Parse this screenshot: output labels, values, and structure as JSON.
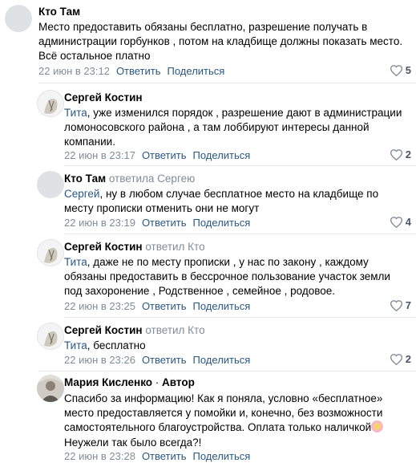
{
  "comments": [
    {
      "author": "Кто Там",
      "reply_to": "",
      "text_parts": [
        "Место предоставить обязаны бесплатно, разрешение получать в",
        "администрации горбунков , потом на кладбище должны показать место.",
        "Всё остальное платно"
      ],
      "date": "22 июн в 23:12",
      "reply_label": "Ответить",
      "share_label": "Поделиться",
      "likes": "5"
    },
    {
      "author": "Сергей Костин",
      "reply_to": "",
      "mention": "Тита",
      "text_parts": [
        ", уже изменился порядок , разрешение дают в администрации",
        "ломоносовского района , а там лоббируют интересы данной",
        "компании."
      ],
      "date": "22 июн в 23:17",
      "reply_label": "Ответить",
      "share_label": "Поделиться",
      "likes": "2"
    },
    {
      "author": "Кто Там",
      "reply_to": "ответила Сергею",
      "mention": "Сергей",
      "text_parts": [
        ", ну в любом случае бесплатное место на кладбище по",
        "месту прописки отменить они не могут"
      ],
      "date": "22 июн в 23:19",
      "reply_label": "Ответить",
      "share_label": "Поделиться",
      "likes": "4"
    },
    {
      "author": "Сергей Костин",
      "reply_to": "ответил Кто",
      "mention": "Тита",
      "text_parts": [
        ", даже не по месту прописки , у нас по закону , каждому",
        "обязаны предоставить в бессрочное пользование участок земли",
        "под захоронение , Родственное , семейное , родовое."
      ],
      "date": "22 июн в 23:25",
      "reply_label": "Ответить",
      "share_label": "Поделиться",
      "likes": "7"
    },
    {
      "author": "Сергей Костин",
      "reply_to": "ответил Кто",
      "mention": "Тита",
      "text_parts": [
        ", бесплатно"
      ],
      "date": "22 июн в 23:26",
      "reply_label": "Ответить",
      "share_label": "Поделиться",
      "likes": "2"
    },
    {
      "author": "Мария Кисленко",
      "author_badge": "Автор",
      "reply_to": "",
      "text_parts": [
        "Спасибо за информацию! Как я поняла, условно «бесплатное»",
        "место предоставляется у помойки и, конечно, без возможности",
        "самостоятельного благоустройства. Оплата только наличкой",
        "Неужели так было всегда?!"
      ],
      "date": "22 июн в 23:28",
      "reply_label": "Ответить",
      "share_label": "Поделиться",
      "likes": ""
    }
  ],
  "colors": {
    "link": "#2a5885",
    "secondary": "#818c99",
    "divider": "#e7e8ec"
  },
  "icons": {
    "like": "heart-icon",
    "emoji": "emoji-icon"
  }
}
